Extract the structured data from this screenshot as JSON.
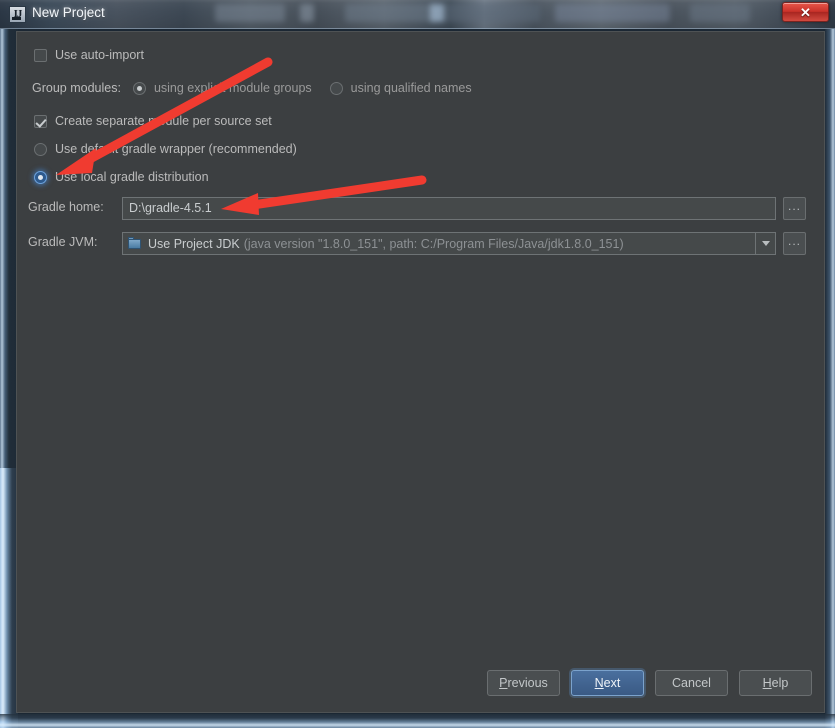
{
  "window": {
    "title": "New Project",
    "app_icon": "intellij-idea-icon",
    "close_label": "✕"
  },
  "form": {
    "auto_import": {
      "label": "Use auto-import",
      "checked": false
    },
    "group_modules": {
      "label": "Group modules:",
      "options": [
        {
          "label": "using explicit module groups",
          "selected": true
        },
        {
          "label": "using qualified names",
          "selected": false
        }
      ]
    },
    "separate_module": {
      "label": "Create separate module per source set",
      "checked": true
    },
    "gradle_source": [
      {
        "label": "Use default gradle wrapper (recommended)",
        "selected": false
      },
      {
        "label": "Use local gradle distribution",
        "selected": true
      }
    ],
    "gradle_home": {
      "label": "Gradle home:",
      "value": "D:\\gradle-4.5.1",
      "browse_label": "..."
    },
    "gradle_jvm": {
      "label": "Gradle JVM:",
      "value_main": "Use Project JDK",
      "value_detail": "(java version \"1.8.0_151\", path: C:/Program Files/Java/jdk1.8.0_151)",
      "browse_label": "..."
    }
  },
  "buttons": {
    "previous": {
      "prefix": "P",
      "rest": "revious"
    },
    "next": {
      "prefix": "N",
      "rest": "ext"
    },
    "cancel": {
      "label": "Cancel"
    },
    "help": {
      "prefix": "H",
      "rest": "elp"
    }
  },
  "annotations": {
    "arrow_1": "red-arrow-pointing-to-use-local-gradle-distribution",
    "arrow_2": "red-arrow-pointing-to-gradle-home-field"
  },
  "colors": {
    "panel_bg": "#3c3f41",
    "field_bg": "#45494a",
    "text": "#bbbbbb",
    "accent_blue": "#3a5a84",
    "annotation_red": "#f03b30",
    "close_red": "#c9322a"
  }
}
